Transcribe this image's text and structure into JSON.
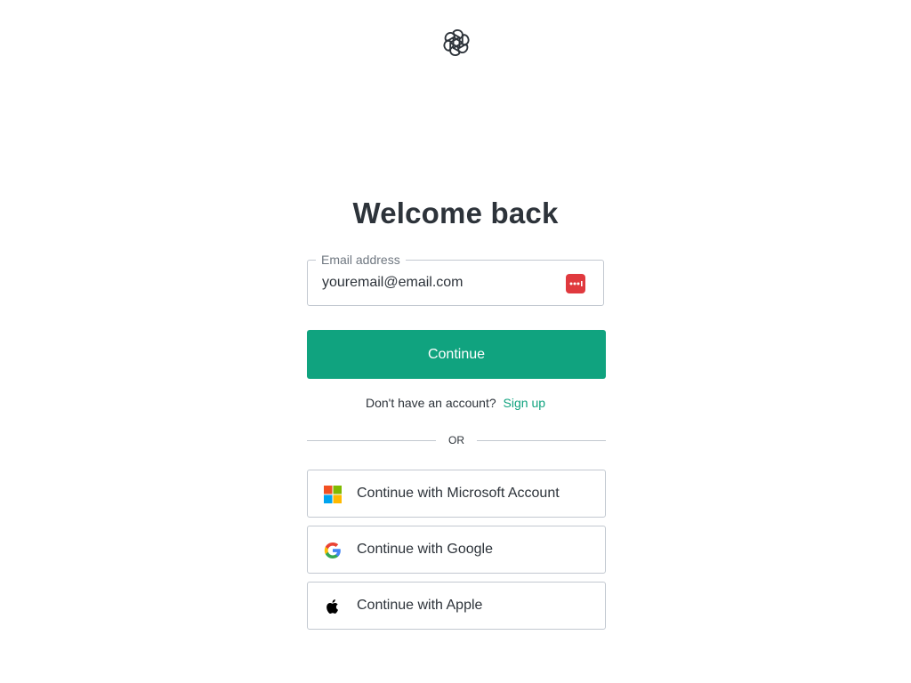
{
  "header": {
    "logo_icon": "openai-logo-icon"
  },
  "main": {
    "title": "Welcome back",
    "email": {
      "label": "Email address",
      "value": "youremail@email.com",
      "password_manager_icon": "password-manager-icon"
    },
    "continue_label": "Continue",
    "signup": {
      "prompt": "Don't have an account?",
      "link": "Sign up"
    },
    "divider_text": "OR",
    "social": [
      {
        "label": "Continue with Microsoft Account",
        "icon": "microsoft-icon"
      },
      {
        "label": "Continue with Google",
        "icon": "google-icon"
      },
      {
        "label": "Continue with Apple",
        "icon": "apple-icon"
      }
    ]
  },
  "colors": {
    "accent": "#10a37f",
    "text": "#2d333a",
    "border": "#c2c8d0",
    "muted": "#6f7780",
    "password_icon_bg": "#e0393e"
  }
}
